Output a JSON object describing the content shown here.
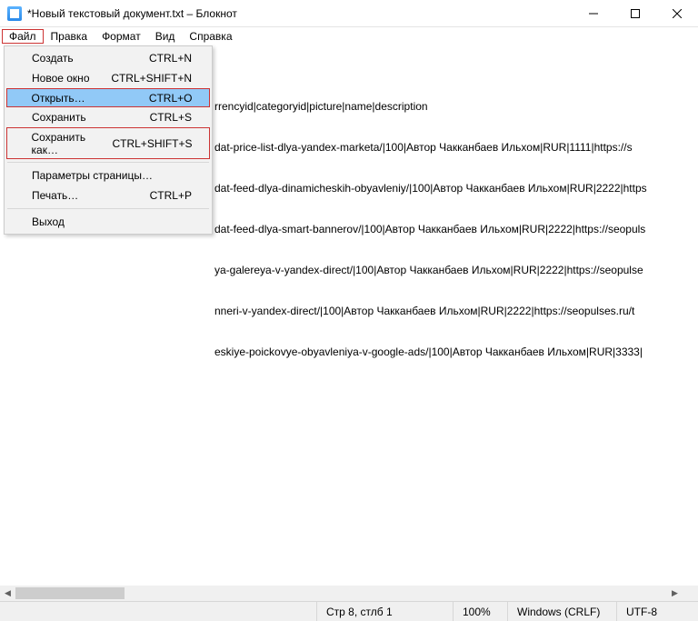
{
  "window": {
    "title": "*Новый текстовый документ.txt – Блокнот"
  },
  "menubar": {
    "items": [
      "Файл",
      "Правка",
      "Формат",
      "Вид",
      "Справка"
    ]
  },
  "dropdown": {
    "items": [
      {
        "label": "Создать",
        "shortcut": "CTRL+N"
      },
      {
        "label": "Новое окно",
        "shortcut": "CTRL+SHIFT+N"
      },
      {
        "label": "Открыть…",
        "shortcut": "CTRL+O"
      },
      {
        "label": "Сохранить",
        "shortcut": "CTRL+S"
      },
      {
        "label": "Сохранить как…",
        "shortcut": "CTRL+SHIFT+S"
      },
      {
        "label": "Параметры страницы…",
        "shortcut": ""
      },
      {
        "label": "Печать…",
        "shortcut": "CTRL+P"
      },
      {
        "label": "Выход",
        "shortcut": ""
      }
    ]
  },
  "editor": {
    "lines": [
      "rrencyid|categoryid|picture|name|description",
      "dat-price-list-dlya-yandex-marketa/|100|Автор Чакканбаев Ильхом|RUR|1111|https://s",
      "dat-feed-dlya-dinamicheskih-obyavleniy/|100|Автор Чакканбаев Ильхом|RUR|2222|https",
      "dat-feed-dlya-smart-bannerov/|100|Автор Чакканбаев Ильхом|RUR|2222|https://seopuls",
      "ya-galereya-v-yandex-direct/|100|Автор Чакканбаев Ильхом|RUR|2222|https://seopulse",
      "nneri-v-yandex-direct/|100|Автор Чакканбаев Ильхом|RUR|2222|https://seopulses.ru/t",
      "eskiye-poickovye-obyavleniya-v-google-ads/|100|Автор Чакканбаев Ильхом|RUR|3333|"
    ]
  },
  "statusbar": {
    "pos": "Стр 8, стлб 1",
    "zoom": "100%",
    "eol": "Windows (CRLF)",
    "encoding": "UTF-8"
  }
}
